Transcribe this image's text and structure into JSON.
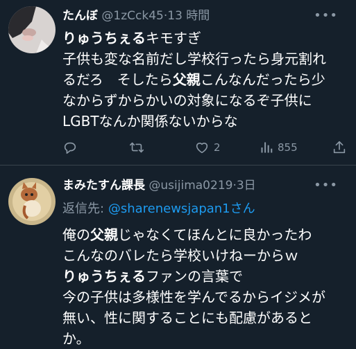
{
  "tweets": [
    {
      "name": "たんぼ",
      "handle": "@1zCck45",
      "separator": "·",
      "time": "13 時間",
      "body": {
        "l1_bold": "りゅうちぇる",
        "l1_rest": "キモすぎ",
        "l2": "子供も変な名前だし学校行ったら身元割れ",
        "l3_a": "るだろ　そしたら",
        "l3_bold": "父親",
        "l3_b": "こんなんだったら少",
        "l4": "なからずからかいの対象になるぞ子供に",
        "l5": "LGBTなんか関係ないからな"
      },
      "actions": {
        "reply_icon": "reply-icon",
        "retweet_icon": "retweet-icon",
        "like_icon": "heart-icon",
        "like_count": "2",
        "views_icon": "views-icon",
        "views_count": "855",
        "share_icon": "share-icon"
      }
    },
    {
      "name": "まみたすん課長",
      "handle": "@usijima0219",
      "separator": "·",
      "time": "3日",
      "reply_label": "返信先:",
      "reply_target": "@sharenewsjapan1",
      "reply_suffix": "さん",
      "body": {
        "l1_a": "俺の",
        "l1_bold": "父親",
        "l1_b": "じゃなくてほんとに良かったわ",
        "l2": "こんなのバレたら学校いけねーからｗ",
        "l3_bold": "りゅうちぇる",
        "l3_rest": "ファンの言葉で",
        "l4": "今の子供は多様性を学んでるからイジメが",
        "l5": "無い、性に関することにも配慮があると",
        "l6": "か。"
      }
    }
  ],
  "colors": {
    "background": "#15202b",
    "text": "#ffffff",
    "secondary": "#8b98a5",
    "link": "#1d9bf0",
    "divider": "#38444d"
  }
}
